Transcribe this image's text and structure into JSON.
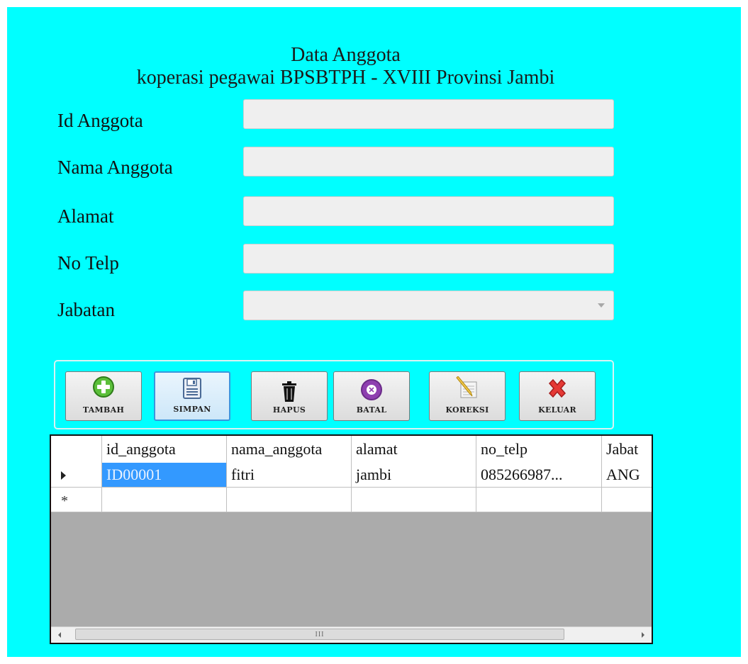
{
  "form": {
    "title_line1": "Data Anggota",
    "title_line2": "koperasi pegawai BPSBTPH - XVIII Provinsi Jambi"
  },
  "fields": {
    "id_anggota": {
      "label": "Id Anggota",
      "value": ""
    },
    "nama_anggota": {
      "label": "Nama Anggota",
      "value": ""
    },
    "alamat": {
      "label": "Alamat",
      "value": ""
    },
    "no_telp": {
      "label": "No Telp",
      "value": ""
    },
    "jabatan": {
      "label": "Jabatan",
      "value": ""
    }
  },
  "toolbar": {
    "tambah": "TAMBAH",
    "simpan": "SIMPAN",
    "hapus": "HAPUS",
    "batal": "BATAL",
    "koreksi": "KOREKSI",
    "keluar": "KELUAR"
  },
  "grid": {
    "columns": [
      "id_anggota",
      "nama_anggota",
      "alamat",
      "no_telp",
      "Jabat"
    ],
    "rows": [
      {
        "id_anggota": "ID00001",
        "nama_anggota": "fitri",
        "alamat": "jambi",
        "no_telp": "085266987...",
        "jabatan": "ANG"
      }
    ],
    "scroll_grip": "III"
  },
  "colors": {
    "form_background": "#00ffff",
    "selected_cell": "#3399ff",
    "grid_empty_area": "#ababab"
  }
}
